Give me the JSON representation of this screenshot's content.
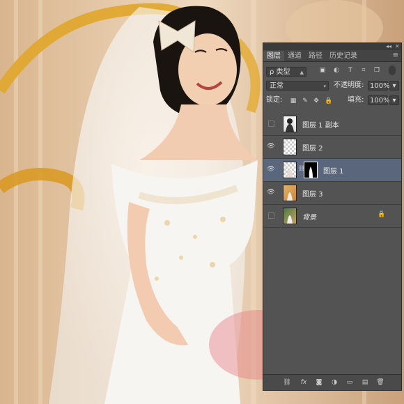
{
  "panel": {
    "tabs": [
      {
        "label": "图层"
      },
      {
        "label": "通道"
      },
      {
        "label": "路径"
      },
      {
        "label": "历史记录"
      }
    ],
    "menu_icon": "≡",
    "filter": {
      "label": "ρ 类型"
    },
    "blend_mode": "正常",
    "opacity_label": "不透明度:",
    "opacity_value": "100%",
    "lock_label": "锁定:",
    "fill_label": "填充:",
    "fill_value": "100%",
    "layers": [
      {
        "name": "图层 1 副本",
        "visible": false
      },
      {
        "name": "图层 2",
        "visible": true
      },
      {
        "name": "图层 1",
        "visible": true,
        "selected": true,
        "has_mask": true
      },
      {
        "name": "图层 3",
        "visible": true
      },
      {
        "name": "背景",
        "visible": false,
        "locked": true
      }
    ]
  },
  "colors": {
    "panel_bg": "#535353",
    "selected_row": "#59667b",
    "tab_strip": "#444444"
  }
}
